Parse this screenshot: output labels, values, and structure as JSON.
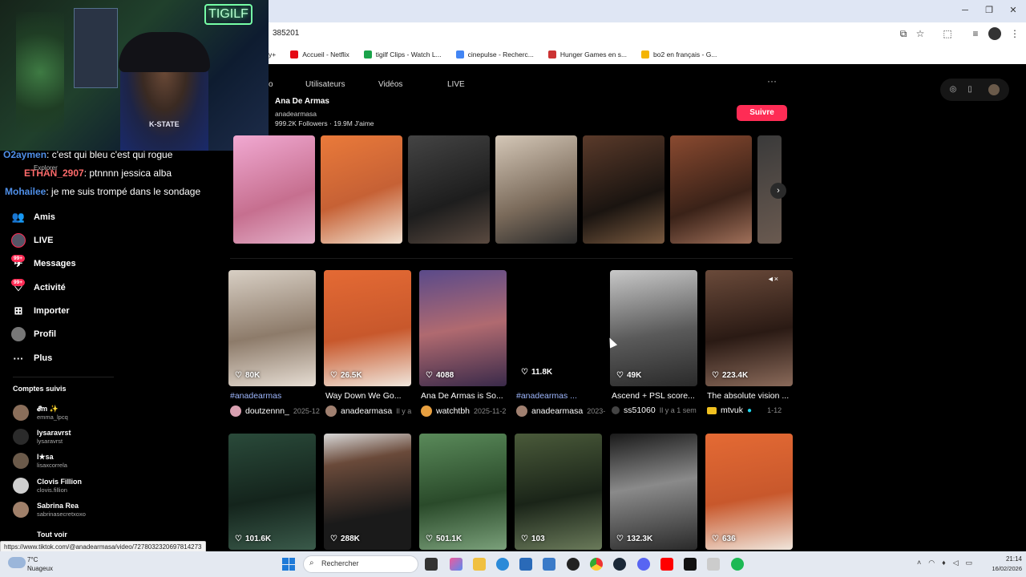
{
  "browser": {
    "url_partial": "385201",
    "bookmarks": [
      {
        "label": "y+",
        "color": "#888888"
      },
      {
        "label": "Accueil - Netflix",
        "color": "#e50914"
      },
      {
        "label": "tigilf Clips - Watch L...",
        "color": "#1aa34a"
      },
      {
        "label": "cinepulse - Recherc...",
        "color": "#4285f4"
      },
      {
        "label": "Hunger Games en s...",
        "color": "#cc3333"
      },
      {
        "label": "bo2 en français - G...",
        "color": "#f4b400"
      }
    ]
  },
  "stream": {
    "neon_sign": "TIGILF",
    "shirt_text": "K-STATE",
    "chat": [
      {
        "user": "O2aymen",
        "user_color": "#4f8fe8",
        "message": ": c'est qui bleu c'est qui rogue"
      },
      {
        "user": "ETHAN_2907",
        "user_color": "#ff6b6b",
        "message": ": ptnnnn jessica alba"
      },
      {
        "user": "Mohailee",
        "user_color": "#4f8fe8",
        "message": ": je me suis trompé dans le sondage"
      }
    ],
    "chat_overlay_partial": "Explorer"
  },
  "sidebar": {
    "nav": [
      {
        "label": "Amis",
        "icon": "friends-icon"
      },
      {
        "label": "LIVE",
        "icon": "live-icon"
      },
      {
        "label": "Messages",
        "icon": "messages-icon",
        "badge": "99+"
      },
      {
        "label": "Activité",
        "icon": "activity-icon",
        "badge": "99+"
      },
      {
        "label": "Importer",
        "icon": "upload-icon"
      },
      {
        "label": "Profil",
        "icon": "profile-icon"
      },
      {
        "label": "Plus",
        "icon": "more-icon"
      }
    ],
    "following_title": "Comptes suivis",
    "following": [
      {
        "name": "𝓔m ✨",
        "handle": "emma_lpcq"
      },
      {
        "name": "lysaravrst",
        "handle": "lysaravrst"
      },
      {
        "name": "l★sa",
        "handle": "lisaxcorrela"
      },
      {
        "name": "Clovis Fillion",
        "handle": "clovis.fillion"
      },
      {
        "name": "Sabrina Rea",
        "handle": "sabrinasecretxoxo"
      }
    ],
    "see_all": "Tout voir"
  },
  "search_tabs": [
    "Utilisateurs",
    "Vidéos",
    "LIVE"
  ],
  "search_tab_partial": "o",
  "profile": {
    "name": "Ana De Armas",
    "handle": "anadearmasa",
    "followers": "999.2K Followers",
    "likes": "19.9M J'aime",
    "follow_label": "Suivre"
  },
  "videos_row1": [
    {
      "likes": "80K",
      "title": "#anadearmas",
      "hashtag": true,
      "author": "doutzennn_",
      "date": "2025-12"
    },
    {
      "likes": "26.5K",
      "title": "Way Down We Go...",
      "hashtag": false,
      "author": "anadearmasa",
      "date": "Il y a"
    },
    {
      "likes": "4088",
      "title": "Ana De Armas is So...",
      "hashtag": false,
      "author": "watchtbh",
      "date": "2025-11-2"
    },
    {
      "likes": "11.8K",
      "title": "#anadearmas ...",
      "hashtag": true,
      "author": "anadearmasa",
      "date": "2023-"
    },
    {
      "likes": "49K",
      "title": "Ascend + PSL score...",
      "hashtag": false,
      "author": "ss51060",
      "date": "Il y a 1 sem"
    },
    {
      "likes": "223.4K",
      "title": "The absolute vision ...",
      "hashtag": false,
      "author": "mtvuk",
      "date": "1-12"
    }
  ],
  "videos_row2": [
    {
      "likes": "101.6K"
    },
    {
      "likes": "288K"
    },
    {
      "likes": "501.1K"
    },
    {
      "likes": "103"
    },
    {
      "likes": "132.3K"
    },
    {
      "likes": "636"
    }
  ],
  "status_url": "https://www.tiktok.com/@anadearmasa/video/7278032320697814273",
  "taskbar": {
    "temp": "7°C",
    "weather": "Nuageux",
    "search_placeholder": "Rechercher",
    "time": "21:14",
    "date": "16/02/2026"
  }
}
